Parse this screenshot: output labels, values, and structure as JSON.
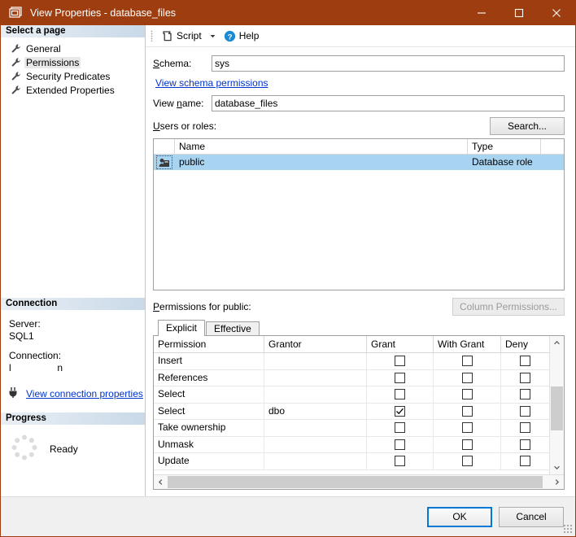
{
  "window": {
    "title": "View Properties - database_files",
    "icon": "view-window-icon",
    "titlebar_color": "#9e3d10",
    "minimize_label": "Minimize",
    "maximize_label": "Maximize",
    "close_label": "Close"
  },
  "sidebar": {
    "select_page_header": "Select a page",
    "pages": [
      {
        "label": "General",
        "selected": false
      },
      {
        "label": "Permissions",
        "selected": true
      },
      {
        "label": "Security Predicates",
        "selected": false
      },
      {
        "label": "Extended Properties",
        "selected": false
      }
    ],
    "connection": {
      "header": "Connection",
      "server_label": "Server:",
      "server_value": "SQL1",
      "connection_label": "Connection:",
      "connection_value": "l                 n",
      "view_connection_link": "View connection properties"
    },
    "progress": {
      "header": "Progress",
      "status": "Ready"
    }
  },
  "toolbar": {
    "script_label": "Script",
    "help_label": "Help"
  },
  "main": {
    "schema_label": "Schema:",
    "schema_value": "sys",
    "view_schema_permissions_link": "View schema permissions",
    "view_name_label": "View name:",
    "view_name_value": "database_files",
    "users_or_roles_label": "Users or roles:",
    "search_button": "Search...",
    "users_grid": {
      "columns": [
        "",
        "Name",
        "Type",
        ""
      ],
      "rows": [
        {
          "icon": "database-role-icon",
          "name": "public",
          "type": "Database role",
          "selected": true
        }
      ]
    },
    "permissions_for_label": "Permissions for public:",
    "column_permissions_button": "Column Permissions...",
    "column_permissions_disabled": true,
    "tabs": [
      {
        "label": "Explicit",
        "active": true
      },
      {
        "label": "Effective",
        "active": false
      }
    ],
    "permissions_table": {
      "columns": [
        "Permission",
        "Grantor",
        "Grant",
        "With Grant",
        "Deny"
      ],
      "rows": [
        {
          "permission": "Insert",
          "grantor": "",
          "grant": false,
          "with_grant": false,
          "deny": false
        },
        {
          "permission": "References",
          "grantor": "",
          "grant": false,
          "with_grant": false,
          "deny": false
        },
        {
          "permission": "Select",
          "grantor": "",
          "grant": false,
          "with_grant": false,
          "deny": false
        },
        {
          "permission": "Select",
          "grantor": "dbo",
          "grant": true,
          "with_grant": false,
          "deny": false
        },
        {
          "permission": "Take ownership",
          "grantor": "",
          "grant": false,
          "with_grant": false,
          "deny": false
        },
        {
          "permission": "Unmask",
          "grantor": "",
          "grant": false,
          "with_grant": false,
          "deny": false
        },
        {
          "permission": "Update",
          "grantor": "",
          "grant": false,
          "with_grant": false,
          "deny": false
        }
      ]
    }
  },
  "footer": {
    "ok_label": "OK",
    "cancel_label": "Cancel"
  }
}
